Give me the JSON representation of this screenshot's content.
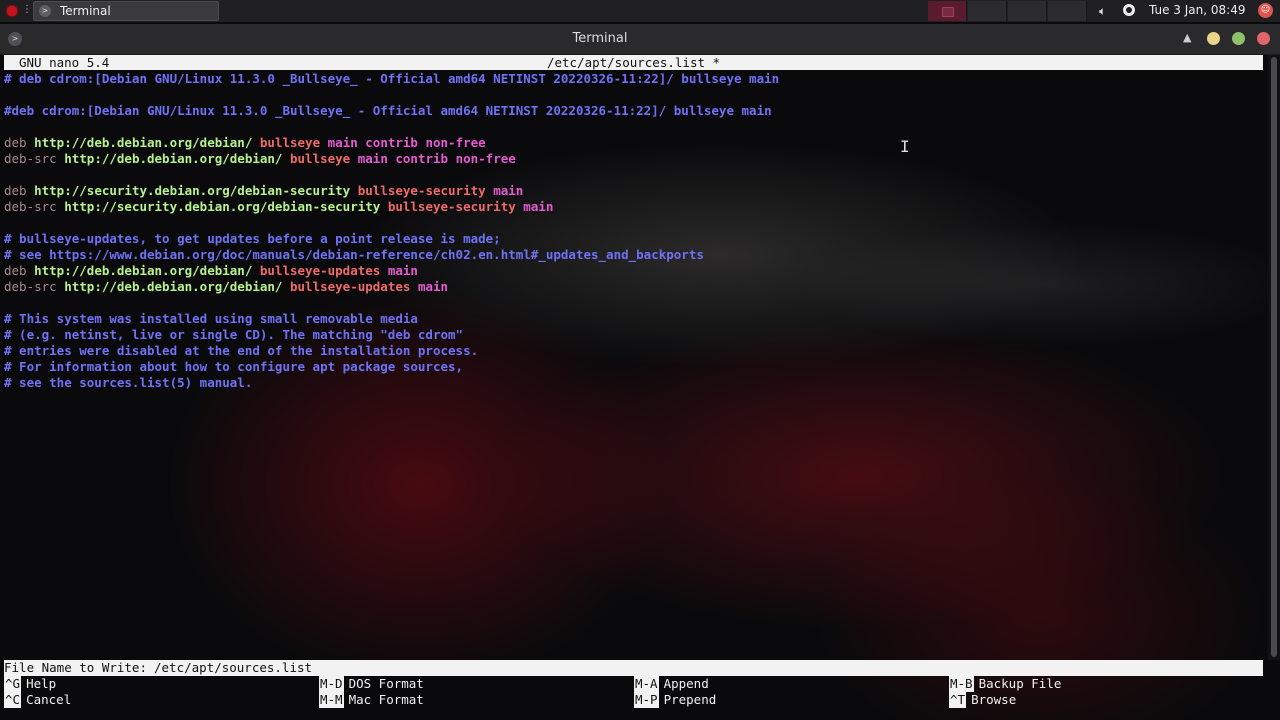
{
  "panel": {
    "task_label": "Terminal",
    "volume_icon": "volume-icon",
    "clock": "Tue  3 Jan, 08:49"
  },
  "window": {
    "title": "Terminal"
  },
  "nano": {
    "version": "GNU nano 5.4",
    "filename": "/etc/apt/sources.list *",
    "lines": [
      [
        {
          "t": "# deb cdrom:[Debian GNU/Linux 11.3.0 _Bullseye_ - Official amd64 NETINST 20220326-11:22]/ bullseye main",
          "c": "comment"
        }
      ],
      [],
      [
        {
          "t": "#deb cdrom:[Debian GNU/Linux 11.3.0 _Bullseye_ - Official amd64 NETINST 20220326-11:22]/ bullseye main",
          "c": "comment"
        }
      ],
      [],
      [
        {
          "t": "deb",
          "c": "kw"
        },
        {
          "t": " "
        },
        {
          "t": "http://deb.debian.org/debian/",
          "c": "url"
        },
        {
          "t": " "
        },
        {
          "t": "bullseye",
          "c": "suite"
        },
        {
          "t": " "
        },
        {
          "t": "main contrib non-free",
          "c": "comp"
        }
      ],
      [
        {
          "t": "deb-src",
          "c": "kw"
        },
        {
          "t": " "
        },
        {
          "t": "http://deb.debian.org/debian/",
          "c": "url"
        },
        {
          "t": " "
        },
        {
          "t": "bullseye",
          "c": "suite"
        },
        {
          "t": " "
        },
        {
          "t": "main contrib non-free",
          "c": "comp"
        }
      ],
      [],
      [
        {
          "t": "deb",
          "c": "kw"
        },
        {
          "t": " "
        },
        {
          "t": "http://security.debian.org/debian-security",
          "c": "url"
        },
        {
          "t": " "
        },
        {
          "t": "bullseye-security",
          "c": "suite"
        },
        {
          "t": " "
        },
        {
          "t": "main",
          "c": "comp"
        }
      ],
      [
        {
          "t": "deb-src",
          "c": "kw"
        },
        {
          "t": " "
        },
        {
          "t": "http://security.debian.org/debian-security",
          "c": "url"
        },
        {
          "t": " "
        },
        {
          "t": "bullseye-security",
          "c": "suite"
        },
        {
          "t": " "
        },
        {
          "t": "main",
          "c": "comp"
        }
      ],
      [],
      [
        {
          "t": "# bullseye-updates, to get updates before a point release is made;",
          "c": "comment"
        }
      ],
      [
        {
          "t": "# see https://www.debian.org/doc/manuals/debian-reference/ch02.en.html#_updates_and_backports",
          "c": "comment"
        }
      ],
      [
        {
          "t": "deb",
          "c": "kw"
        },
        {
          "t": " "
        },
        {
          "t": "http://deb.debian.org/debian/",
          "c": "url"
        },
        {
          "t": " "
        },
        {
          "t": "bullseye-updates",
          "c": "suite"
        },
        {
          "t": " "
        },
        {
          "t": "main",
          "c": "comp"
        }
      ],
      [
        {
          "t": "deb-src",
          "c": "kw"
        },
        {
          "t": " "
        },
        {
          "t": "http://deb.debian.org/debian/",
          "c": "url"
        },
        {
          "t": " "
        },
        {
          "t": "bullseye-updates",
          "c": "suite"
        },
        {
          "t": " "
        },
        {
          "t": "main",
          "c": "comp"
        }
      ],
      [],
      [
        {
          "t": "# This system was installed using small removable media",
          "c": "comment"
        }
      ],
      [
        {
          "t": "# (e.g. netinst, live or single CD). The matching \"deb cdrom\"",
          "c": "comment"
        }
      ],
      [
        {
          "t": "# entries were disabled at the end of the installation process.",
          "c": "comment"
        }
      ],
      [
        {
          "t": "# For information about how to configure apt package sources,",
          "c": "comment"
        }
      ],
      [
        {
          "t": "# see the sources.list(5) manual.",
          "c": "comment"
        }
      ]
    ],
    "prompt": {
      "label": "File Name to Write:",
      "value": "/etc/apt/sources.list"
    },
    "shortcuts": [
      {
        "key": "^G",
        "label": "Help"
      },
      {
        "key": "^C",
        "label": "Cancel"
      },
      {
        "key": "M-D",
        "label": "DOS Format"
      },
      {
        "key": "M-M",
        "label": "Mac Format"
      },
      {
        "key": "M-A",
        "label": "Append"
      },
      {
        "key": "M-P",
        "label": "Prepend"
      },
      {
        "key": "M-B",
        "label": "Backup File"
      },
      {
        "key": "^T",
        "label": "Browse"
      }
    ]
  },
  "colors": {
    "comment": "#6f72f5",
    "keyword": "#a78a8a",
    "url": "#b7f28d",
    "suite": "#f06a6a",
    "components": "#e55bd0"
  }
}
